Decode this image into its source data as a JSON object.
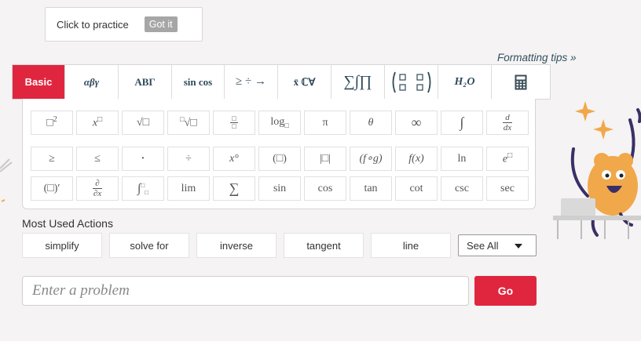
{
  "tooltip": {
    "text": "Click to practice",
    "button": "Got it"
  },
  "formatting_tips": "Formatting tips »",
  "tabs": [
    {
      "label": "Basic",
      "active": true
    },
    {
      "label": "αβγ"
    },
    {
      "label": "ΑΒΓ"
    },
    {
      "label": "sin cos"
    },
    {
      "label": "≥ ÷ →"
    },
    {
      "label": "x̄ ℂ∀"
    },
    {
      "label": "∑∫∏"
    },
    {
      "label": "matrix"
    },
    {
      "label": "H₂O"
    },
    {
      "label": "calculator"
    }
  ],
  "keypad": {
    "row1": [
      "□²",
      "x□",
      "√□",
      "□√□",
      "□/□",
      "log□",
      "π",
      "θ",
      "∞",
      "∫",
      "d/dx"
    ],
    "row2": [
      "≥",
      "≤",
      "·",
      "÷",
      "x°",
      "(□)",
      "|□|",
      "(f∘g)",
      "f(x)",
      "ln",
      "e□"
    ],
    "row3": [
      "(□)′",
      "∂/∂x",
      "∫□□",
      "lim",
      "∑",
      "sin",
      "cos",
      "tan",
      "cot",
      "csc",
      "sec"
    ]
  },
  "most_used": {
    "label": "Most Used Actions",
    "actions": [
      "simplify",
      "solve for",
      "inverse",
      "tangent",
      "line"
    ],
    "see_all": "See All"
  },
  "input": {
    "placeholder": "Enter a problem",
    "go_label": "Go"
  },
  "colors": {
    "accent": "#e0263f",
    "tab_text": "#2f4a5a",
    "mascot": "#f0a84a"
  }
}
